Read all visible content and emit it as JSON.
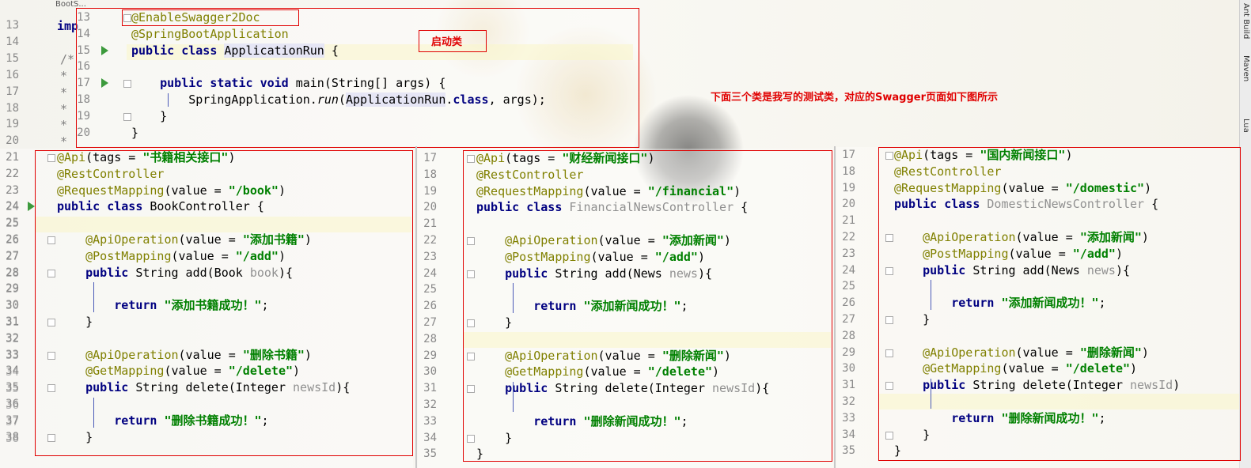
{
  "topbar": {
    "tab": "BootS..."
  },
  "toolbar_right": [
    "Ant Build",
    "Maven",
    "Lua"
  ],
  "labels": {
    "startup": "启动类",
    "note": "下面三个类是我写的测试类，对应的Swagger页面如下图所示"
  },
  "main_gutter": {
    "lines": [
      "13",
      "14",
      "15",
      "16",
      "17",
      "18",
      "19",
      "20",
      "21",
      "22",
      "23",
      "24",
      "25",
      "26",
      "27",
      "28",
      "29",
      "30",
      "31",
      "32",
      "33",
      "34",
      "35",
      "36",
      "37",
      "38"
    ],
    "snippets": [
      "imp",
      "",
      "/*",
      "*",
      "*",
      "*",
      "*",
      "*"
    ]
  },
  "app_panel": {
    "lines": [
      {
        "n": "13",
        "t": "@EnableSwagger2Doc"
      },
      {
        "n": "14",
        "t": "@SpringBootApplication"
      },
      {
        "n": "15",
        "t": "public class ApplicationRun {"
      },
      {
        "n": "16",
        "t": ""
      },
      {
        "n": "17",
        "t": "    public static void main(String[] args) {"
      },
      {
        "n": "18",
        "t": "        SpringApplication.run(ApplicationRun.class, args);"
      },
      {
        "n": "19",
        "t": "    }"
      },
      {
        "n": "20",
        "t": "}"
      }
    ]
  },
  "book_panel": {
    "lines": [
      {
        "n": "21",
        "t": "@Api(tags = \"书籍相关接口\")"
      },
      {
        "n": "22",
        "t": "@RestController"
      },
      {
        "n": "23",
        "t": "@RequestMapping(value = \"/book\")"
      },
      {
        "n": "24",
        "t": "public class BookController {"
      },
      {
        "n": "25",
        "t": ""
      },
      {
        "n": "26",
        "t": "    @ApiOperation(value = \"添加书籍\")"
      },
      {
        "n": "27",
        "t": "    @PostMapping(value = \"/add\")"
      },
      {
        "n": "28",
        "t": "    public String add(Book book){"
      },
      {
        "n": "29",
        "t": ""
      },
      {
        "n": "30",
        "t": "        return \"添加书籍成功！\";"
      },
      {
        "n": "31",
        "t": "    }"
      },
      {
        "n": "32",
        "t": ""
      },
      {
        "n": "33",
        "t": "    @ApiOperation(value = \"删除书籍\")"
      },
      {
        "n": "34",
        "t": "    @GetMapping(value = \"/delete\")"
      },
      {
        "n": "35",
        "t": "    public String delete(Integer newsId){"
      },
      {
        "n": "36",
        "t": ""
      },
      {
        "n": "37",
        "t": "        return \"删除书籍成功！\";"
      },
      {
        "n": "38",
        "t": "    }"
      }
    ]
  },
  "financial_panel": {
    "lines": [
      {
        "n": "17",
        "t": "@Api(tags = \"财经新闻接口\")"
      },
      {
        "n": "18",
        "t": "@RestController"
      },
      {
        "n": "19",
        "t": "@RequestMapping(value = \"/financial\")"
      },
      {
        "n": "20",
        "t": "public class FinancialNewsController {"
      },
      {
        "n": "21",
        "t": ""
      },
      {
        "n": "22",
        "t": "    @ApiOperation(value = \"添加新闻\")"
      },
      {
        "n": "23",
        "t": "    @PostMapping(value = \"/add\")"
      },
      {
        "n": "24",
        "t": "    public String add(News news){"
      },
      {
        "n": "25",
        "t": ""
      },
      {
        "n": "26",
        "t": "        return \"添加新闻成功！\";"
      },
      {
        "n": "27",
        "t": "    }"
      },
      {
        "n": "28",
        "t": ""
      },
      {
        "n": "29",
        "t": "    @ApiOperation(value = \"删除新闻\")"
      },
      {
        "n": "30",
        "t": "    @GetMapping(value = \"/delete\")"
      },
      {
        "n": "31",
        "t": "    public String delete(Integer newsId){"
      },
      {
        "n": "32",
        "t": ""
      },
      {
        "n": "33",
        "t": "        return \"删除新闻成功！\";"
      },
      {
        "n": "34",
        "t": "    }"
      },
      {
        "n": "35",
        "t": "}"
      }
    ]
  },
  "domestic_panel": {
    "lines": [
      {
        "n": "17",
        "t": "@Api(tags = \"国内新闻接口\")"
      },
      {
        "n": "18",
        "t": "@RestController"
      },
      {
        "n": "19",
        "t": "@RequestMapping(value = \"/domestic\")"
      },
      {
        "n": "20",
        "t": "public class DomesticNewsController {"
      },
      {
        "n": "21",
        "t": ""
      },
      {
        "n": "22",
        "t": "    @ApiOperation(value = \"添加新闻\")"
      },
      {
        "n": "23",
        "t": "    @PostMapping(value = \"/add\")"
      },
      {
        "n": "24",
        "t": "    public String add(News news){"
      },
      {
        "n": "25",
        "t": ""
      },
      {
        "n": "26",
        "t": "        return \"添加新闻成功！\";"
      },
      {
        "n": "27",
        "t": "    }"
      },
      {
        "n": "28",
        "t": ""
      },
      {
        "n": "29",
        "t": "    @ApiOperation(value = \"删除新闻\")"
      },
      {
        "n": "30",
        "t": "    @GetMapping(value = \"/delete\")"
      },
      {
        "n": "31",
        "t": "    public String delete(Integer newsId)"
      },
      {
        "n": "32",
        "t": ""
      },
      {
        "n": "33",
        "t": "        return \"删除新闻成功！\";"
      },
      {
        "n": "34",
        "t": "    }"
      },
      {
        "n": "35",
        "t": "}"
      }
    ]
  },
  "colors": {
    "keyword": "#000080",
    "annotation": "#808000",
    "string": "#008000",
    "highlight_box": "#e00000"
  }
}
